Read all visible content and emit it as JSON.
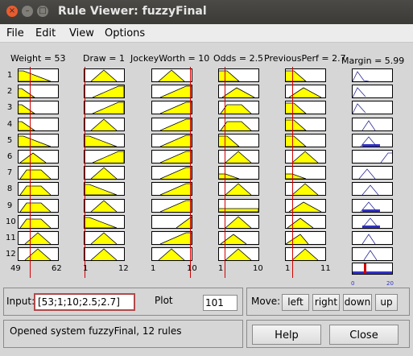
{
  "window": {
    "title": "Rule Viewer: fuzzyFinal",
    "close_glyph": "×",
    "min_glyph": "–",
    "max_glyph": "□"
  },
  "menu": [
    "File",
    "Edit",
    "View",
    "Options"
  ],
  "variables": [
    {
      "label": "Weight = 53",
      "min_tick": "49",
      "max_tick": "62",
      "value": 53
    },
    {
      "label": "Draw = 1",
      "min_tick": "1",
      "max_tick": "12",
      "value": 1
    },
    {
      "label": "JockeyWorth = 10",
      "min_tick": "1",
      "max_tick": "10",
      "value": 10
    },
    {
      "label": "Odds = 2.5",
      "min_tick": "1",
      "max_tick": "10",
      "value": 2.5
    },
    {
      "label": "PreviousPerf = 2.7",
      "min_tick": "1",
      "max_tick": "11",
      "value": 2.7
    }
  ],
  "output": {
    "label": "Margin = 5.99",
    "value": 5.99,
    "min_tick": "0",
    "max_tick": "20"
  },
  "rules": [
    "1",
    "2",
    "3",
    "4",
    "5",
    "6",
    "7",
    "8",
    "9",
    "10",
    "11",
    "12"
  ],
  "input": {
    "label": "Input:",
    "value": "[53;1;10;2.5;2.7]"
  },
  "plot": {
    "label": "Plot",
    "value": "101"
  },
  "move": {
    "label": "Move:",
    "left": "left",
    "right": "right",
    "down": "down",
    "up": "up"
  },
  "status": "Opened system fuzzyFinal, 12 rules",
  "buttons": {
    "help": "Help",
    "close": "Close"
  },
  "colors": {
    "fill": "#ffff00",
    "line": "#d40000",
    "output": "#3232c8",
    "curve": "#000000"
  }
}
